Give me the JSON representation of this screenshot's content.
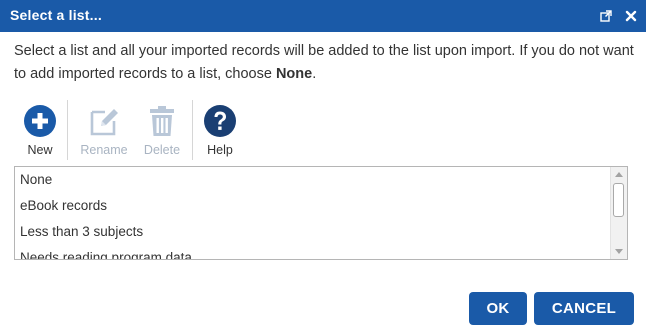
{
  "dialog": {
    "title": "Select a list..."
  },
  "message": {
    "text": "Select a list and all your imported records will be added to the list upon import. If you do not want to add imported records to a list, choose ",
    "emphasis": "None",
    "suffix": "."
  },
  "toolbar": {
    "new_label": "New",
    "rename_label": "Rename",
    "delete_label": "Delete",
    "help_label": "Help",
    "rename_enabled": false,
    "delete_enabled": false
  },
  "list": {
    "items": [
      {
        "label": "None"
      },
      {
        "label": "eBook records"
      },
      {
        "label": "Less than 3 subjects"
      },
      {
        "label": "Needs reading program data"
      }
    ]
  },
  "buttons": {
    "ok_label": "OK",
    "cancel_label": "CANCEL"
  },
  "colors": {
    "primary": "#1a5aa8",
    "disabled_icon": "#b9c7d8"
  },
  "icons": {
    "popout": "popout-icon",
    "close": "close-icon",
    "new": "plus-circle-icon",
    "rename": "pencil-icon",
    "delete": "trash-icon",
    "help": "question-circle-icon"
  }
}
